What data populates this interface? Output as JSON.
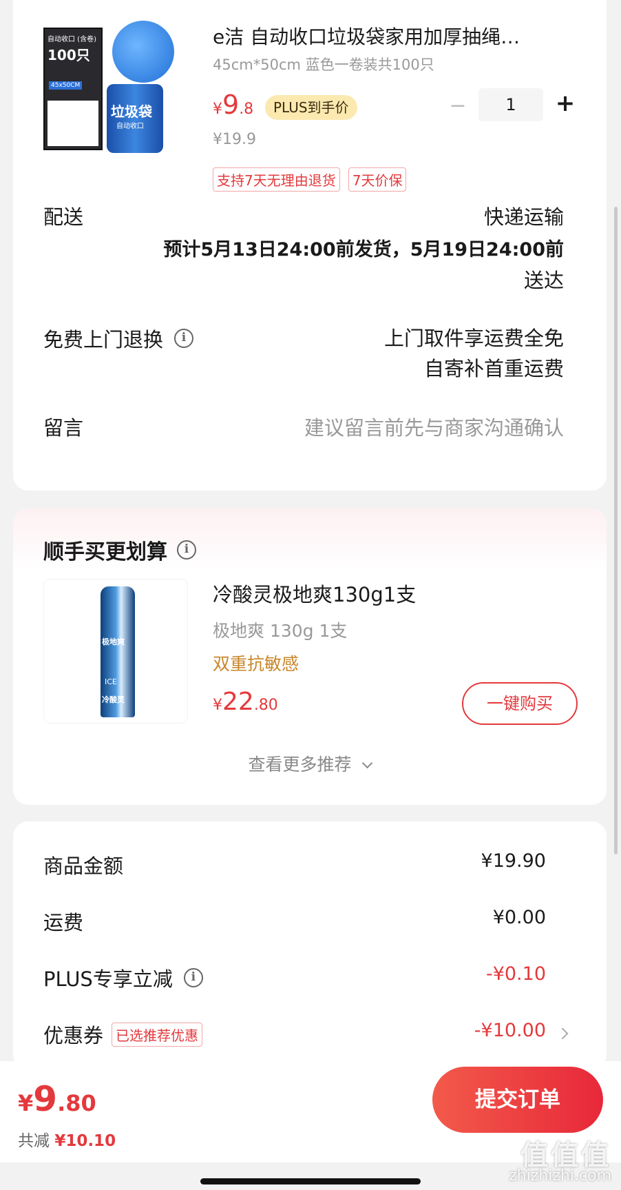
{
  "product": {
    "title": "e洁 自动收口垃圾袋家用加厚抽绳…",
    "spec": "45cm*50cm 蓝色一卷装共100只",
    "price_symbol": "¥",
    "price_int": "9",
    "price_dec": ".8",
    "plus_badge": "PLUS到手价",
    "orig_price": "¥19.9",
    "qty": "1",
    "minus": "−",
    "plus": "+",
    "tags": [
      "支持7天无理由退货",
      "7天价保"
    ],
    "img_box_title": "自动收口 (含卷)",
    "img_box_count": "100只",
    "img_box_size": "45x50CM",
    "img_can_text": "垃圾袋",
    "img_can_sub": "自动收口"
  },
  "delivery": {
    "label": "配送",
    "method": "快递运输",
    "line1": "预计5月13日24:00前发货，5月19日24:00前",
    "line2": "送达"
  },
  "returns": {
    "label": "免费上门退换",
    "line1": "上门取件享运费全免",
    "line2": "自寄补首重运费"
  },
  "message": {
    "label": "留言",
    "placeholder": "建议留言前先与商家沟通确认"
  },
  "recommend": {
    "title": "顺手买更划算",
    "item_title": "冷酸灵极地爽130g1支",
    "item_spec": "极地爽 130g 1支",
    "item_feature": "双重抗敏感",
    "price_symbol": "¥",
    "price_int": "22",
    "price_dec": ".80",
    "buy_button": "一键购买",
    "more": "查看更多推荐",
    "img_text": "极地爽",
    "img_text2": "ICE",
    "img_text3": "冷酸灵"
  },
  "summary": {
    "rows": [
      {
        "label": "商品金额",
        "value": "¥19.90"
      },
      {
        "label": "运费",
        "value": "¥0.00"
      },
      {
        "label": "PLUS专享立减",
        "value": "-¥0.10"
      },
      {
        "label": "优惠券",
        "value": "-¥10.00"
      }
    ],
    "coupon_tag": "已选推荐优惠"
  },
  "footer": {
    "price_symbol": "¥",
    "price_int": "9",
    "price_dec": ".80",
    "saved_label": "共减",
    "saved_value": "¥10.10",
    "submit": "提交订单"
  },
  "watermark": {
    "text": "zhizhizhi.com",
    "logo": "值值值"
  },
  "colors": {
    "accent": "#e4393c",
    "plus_badge_bg": "#fbe9b0",
    "feature": "#c8862a",
    "submit_bg": "#ec3a3a"
  }
}
